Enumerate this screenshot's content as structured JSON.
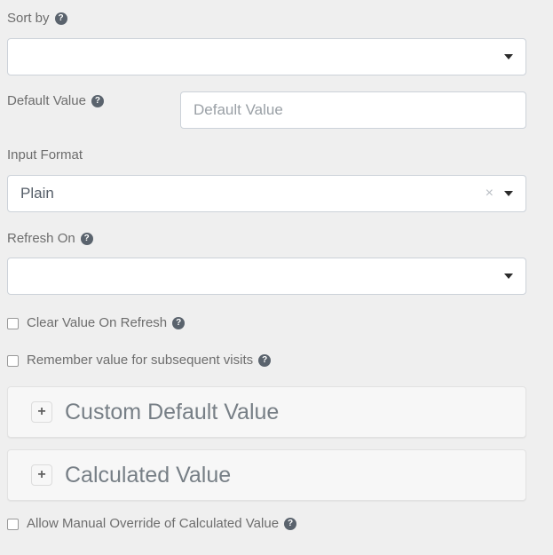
{
  "theme": {
    "page_background": "#efefef",
    "control_background": "#ffffff",
    "panel_background": "#f7f7f7",
    "label_color": "#6d6d6d",
    "value_color": "#555e68",
    "placeholder_color": "#9aa0a6",
    "border_color": "#ccd2d9",
    "help_icon_color": "#5a636d"
  },
  "fields": {
    "sort_by": {
      "label": "Sort by",
      "help_icon": "help-circle-icon",
      "has_help": true,
      "value": "",
      "dropdown_icon": "chevron-down-icon"
    },
    "default_value": {
      "label": "Default Value",
      "help_icon": "help-circle-icon",
      "has_help": true,
      "value": "",
      "placeholder": "Default Value"
    },
    "input_format": {
      "label": "Input Format",
      "has_help": false,
      "value": "Plain",
      "clear_icon": "close-x-icon",
      "dropdown_icon": "chevron-down-icon"
    },
    "refresh_on": {
      "label": "Refresh On",
      "help_icon": "help-circle-icon",
      "has_help": true,
      "value": "",
      "dropdown_icon": "chevron-down-icon"
    }
  },
  "checkboxes": [
    {
      "label": "Clear Value On Refresh",
      "checked": false,
      "has_help": true,
      "help_icon": "help-circle-icon"
    },
    {
      "label": "Remember value for subsequent visits",
      "checked": false,
      "has_help": true,
      "help_icon": "help-circle-icon"
    },
    {
      "label": "Allow Manual Override of Calculated Value",
      "checked": false,
      "has_help": true,
      "help_icon": "help-circle-icon"
    }
  ],
  "accordions": [
    {
      "title": "Custom Default Value",
      "expand_label": "+",
      "expand_icon": "plus-icon",
      "expanded": false
    },
    {
      "title": "Calculated Value",
      "expand_label": "+",
      "expand_icon": "plus-icon",
      "expanded": false
    }
  ],
  "help_glyph": "?"
}
